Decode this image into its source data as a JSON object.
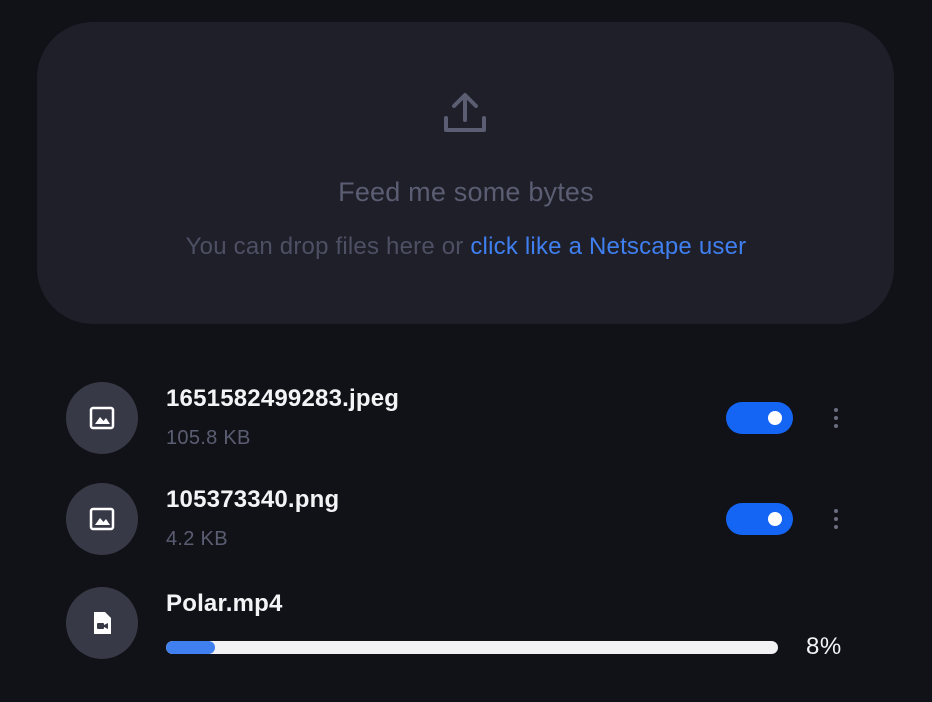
{
  "dropzone": {
    "icon": "upload-icon",
    "title": "Feed me some bytes",
    "subtitle_prefix": "You can drop files here or ",
    "link_text": "click like a Netscape user"
  },
  "files": [
    {
      "icon": "image-icon",
      "name": "1651582499283.jpeg",
      "size": "105.8 KB",
      "toggle_on": true
    },
    {
      "icon": "image-icon",
      "name": "105373340.png",
      "size": "4.2 KB",
      "toggle_on": true
    },
    {
      "icon": "video-file-icon",
      "name": "Polar.mp4",
      "progress": 8,
      "progress_label": "8%"
    }
  ],
  "colors": {
    "background": "#111217",
    "dropzone": "#1e1f29",
    "accent": "#3f7fef",
    "toggle": "#1565f5"
  }
}
